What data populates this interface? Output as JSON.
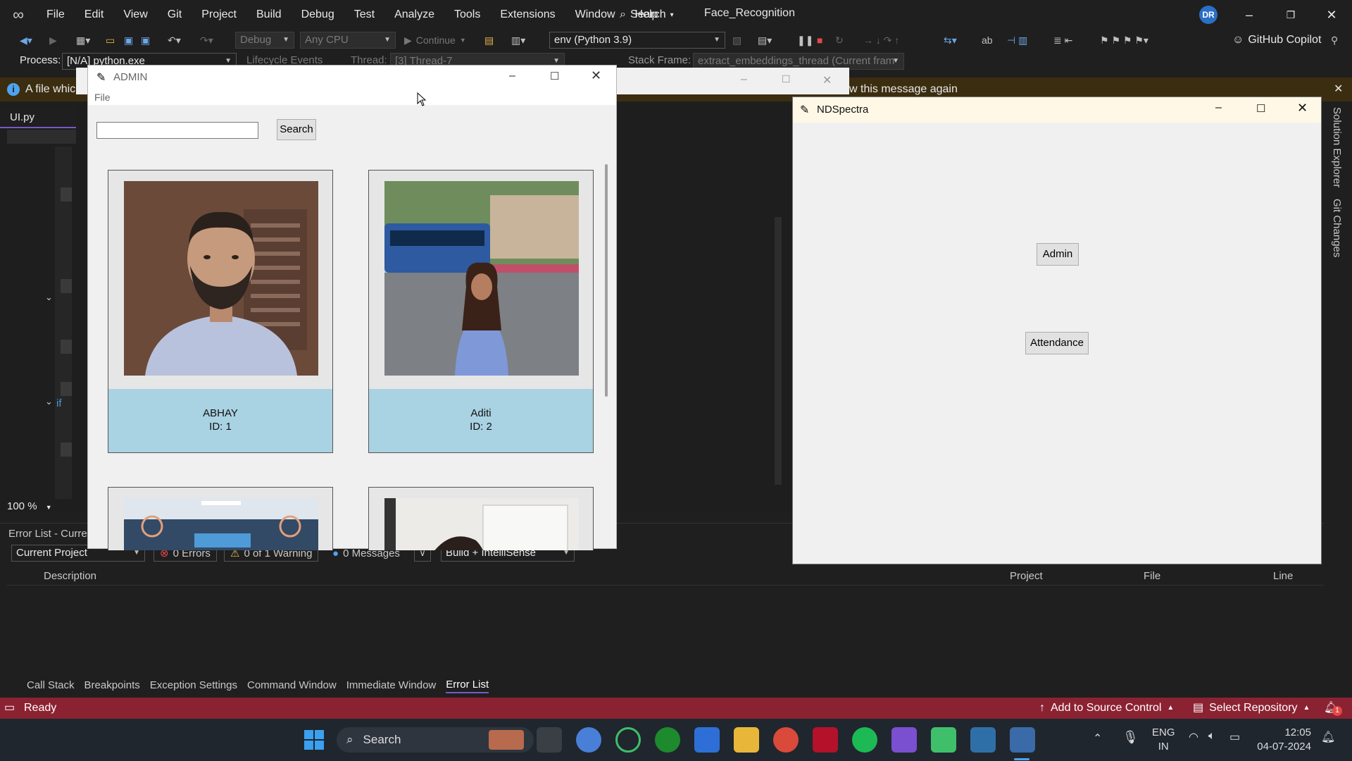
{
  "titlebar": {
    "menu": [
      "File",
      "Edit",
      "View",
      "Git",
      "Project",
      "Build",
      "Debug",
      "Test",
      "Analyze",
      "Tools",
      "Extensions",
      "Window",
      "Help"
    ],
    "search_label": "Search",
    "solution_title": "Face_Recognition",
    "avatar_initials": "DR"
  },
  "toolbar": {
    "config": "Debug",
    "platform": "Any CPU",
    "continue_label": "Continue",
    "environment": "env (Python 3.9)",
    "copilot_label": "GitHub Copilot"
  },
  "debugbar": {
    "process_label": "Process:",
    "process_value": "[N/A] python.exe",
    "lifecycle_label": "Lifecycle Events",
    "thread_label": "Thread:",
    "thread_value": "[3] Thread-7",
    "stackframe_label": "Stack Frame:",
    "stackframe_value": "extract_embeddings_thread (Current fram"
  },
  "infobar": {
    "text_left": "A file whic",
    "text_right": "w this message again"
  },
  "editor": {
    "tab_label": "UI.py",
    "zoom": "100 %",
    "keyword_if": "if"
  },
  "errorlist": {
    "title": "Error List - Curre",
    "scope": "Current Project",
    "errors": "0 Errors",
    "warnings": "0 of 1 Warning",
    "messages": "0 Messages",
    "build_filter": "Build + IntelliSense",
    "columns": {
      "description": "Description",
      "project": "Project",
      "file": "File",
      "line": "Line"
    }
  },
  "bottom_tabs": [
    "Call Stack",
    "Breakpoints",
    "Exception Settings",
    "Command Window",
    "Immediate Window",
    "Error List"
  ],
  "statusbar": {
    "ready": "Ready",
    "source_control": "Add to Source Control",
    "repository": "Select Repository",
    "notifications": "1"
  },
  "right_tabs": [
    "Solution Explorer",
    "Git Changes"
  ],
  "admin_window": {
    "title": "ADMIN",
    "menu_file": "File",
    "search_value": "",
    "search_button": "Search",
    "people": [
      {
        "name": "ABHAY",
        "id": "ID: 1"
      },
      {
        "name": "Aditi",
        "id": "ID: 2"
      }
    ]
  },
  "nds_window": {
    "title": "NDSpectra",
    "admin_button": "Admin",
    "attendance_button": "Attendance"
  },
  "taskbar": {
    "search_label": "Search",
    "lang_top": "ENG",
    "lang_bottom": "IN",
    "time": "12:05",
    "date": "04-07-2024"
  },
  "colors": {
    "status_bar": "#8b2232",
    "card_caption": "#a9d2e2",
    "accent_blue": "#2b6fc7"
  }
}
